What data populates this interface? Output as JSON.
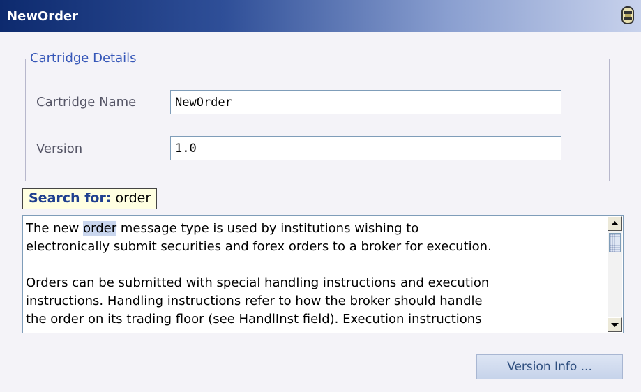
{
  "window": {
    "title": "NewOrder"
  },
  "cartridge_details": {
    "legend": "Cartridge Details",
    "name_label": "Cartridge Name",
    "name_value": "NewOrder",
    "version_label": "Version",
    "version_value": "1.0"
  },
  "search": {
    "label": "Search for:",
    "term": "order"
  },
  "description": {
    "line1_before": "The new ",
    "line1_highlight": "order",
    "line1_after": " message type is used by institutions wishing to",
    "line2": "electronically submit securities and forex orders to a broker for execution.",
    "line3": "Orders can be submitted with special handling instructions and execution",
    "line4": "instructions.  Handling instructions refer to how the broker should handle",
    "line5": "the order on its trading floor (see HandlInst field).  Execution instructions"
  },
  "buttons": {
    "version_info": "Version Info ..."
  },
  "icons": {
    "title_icon": "cartridge-icon",
    "scroll_up": "scroll-up-icon",
    "scroll_down": "scroll-down-icon"
  },
  "colors": {
    "title_start": "#0d2a6e",
    "title_end": "#c8d2ec",
    "legend_text": "#3657b8",
    "highlight": "#c9d6ee",
    "tooltip_bg": "#ffffe1"
  }
}
